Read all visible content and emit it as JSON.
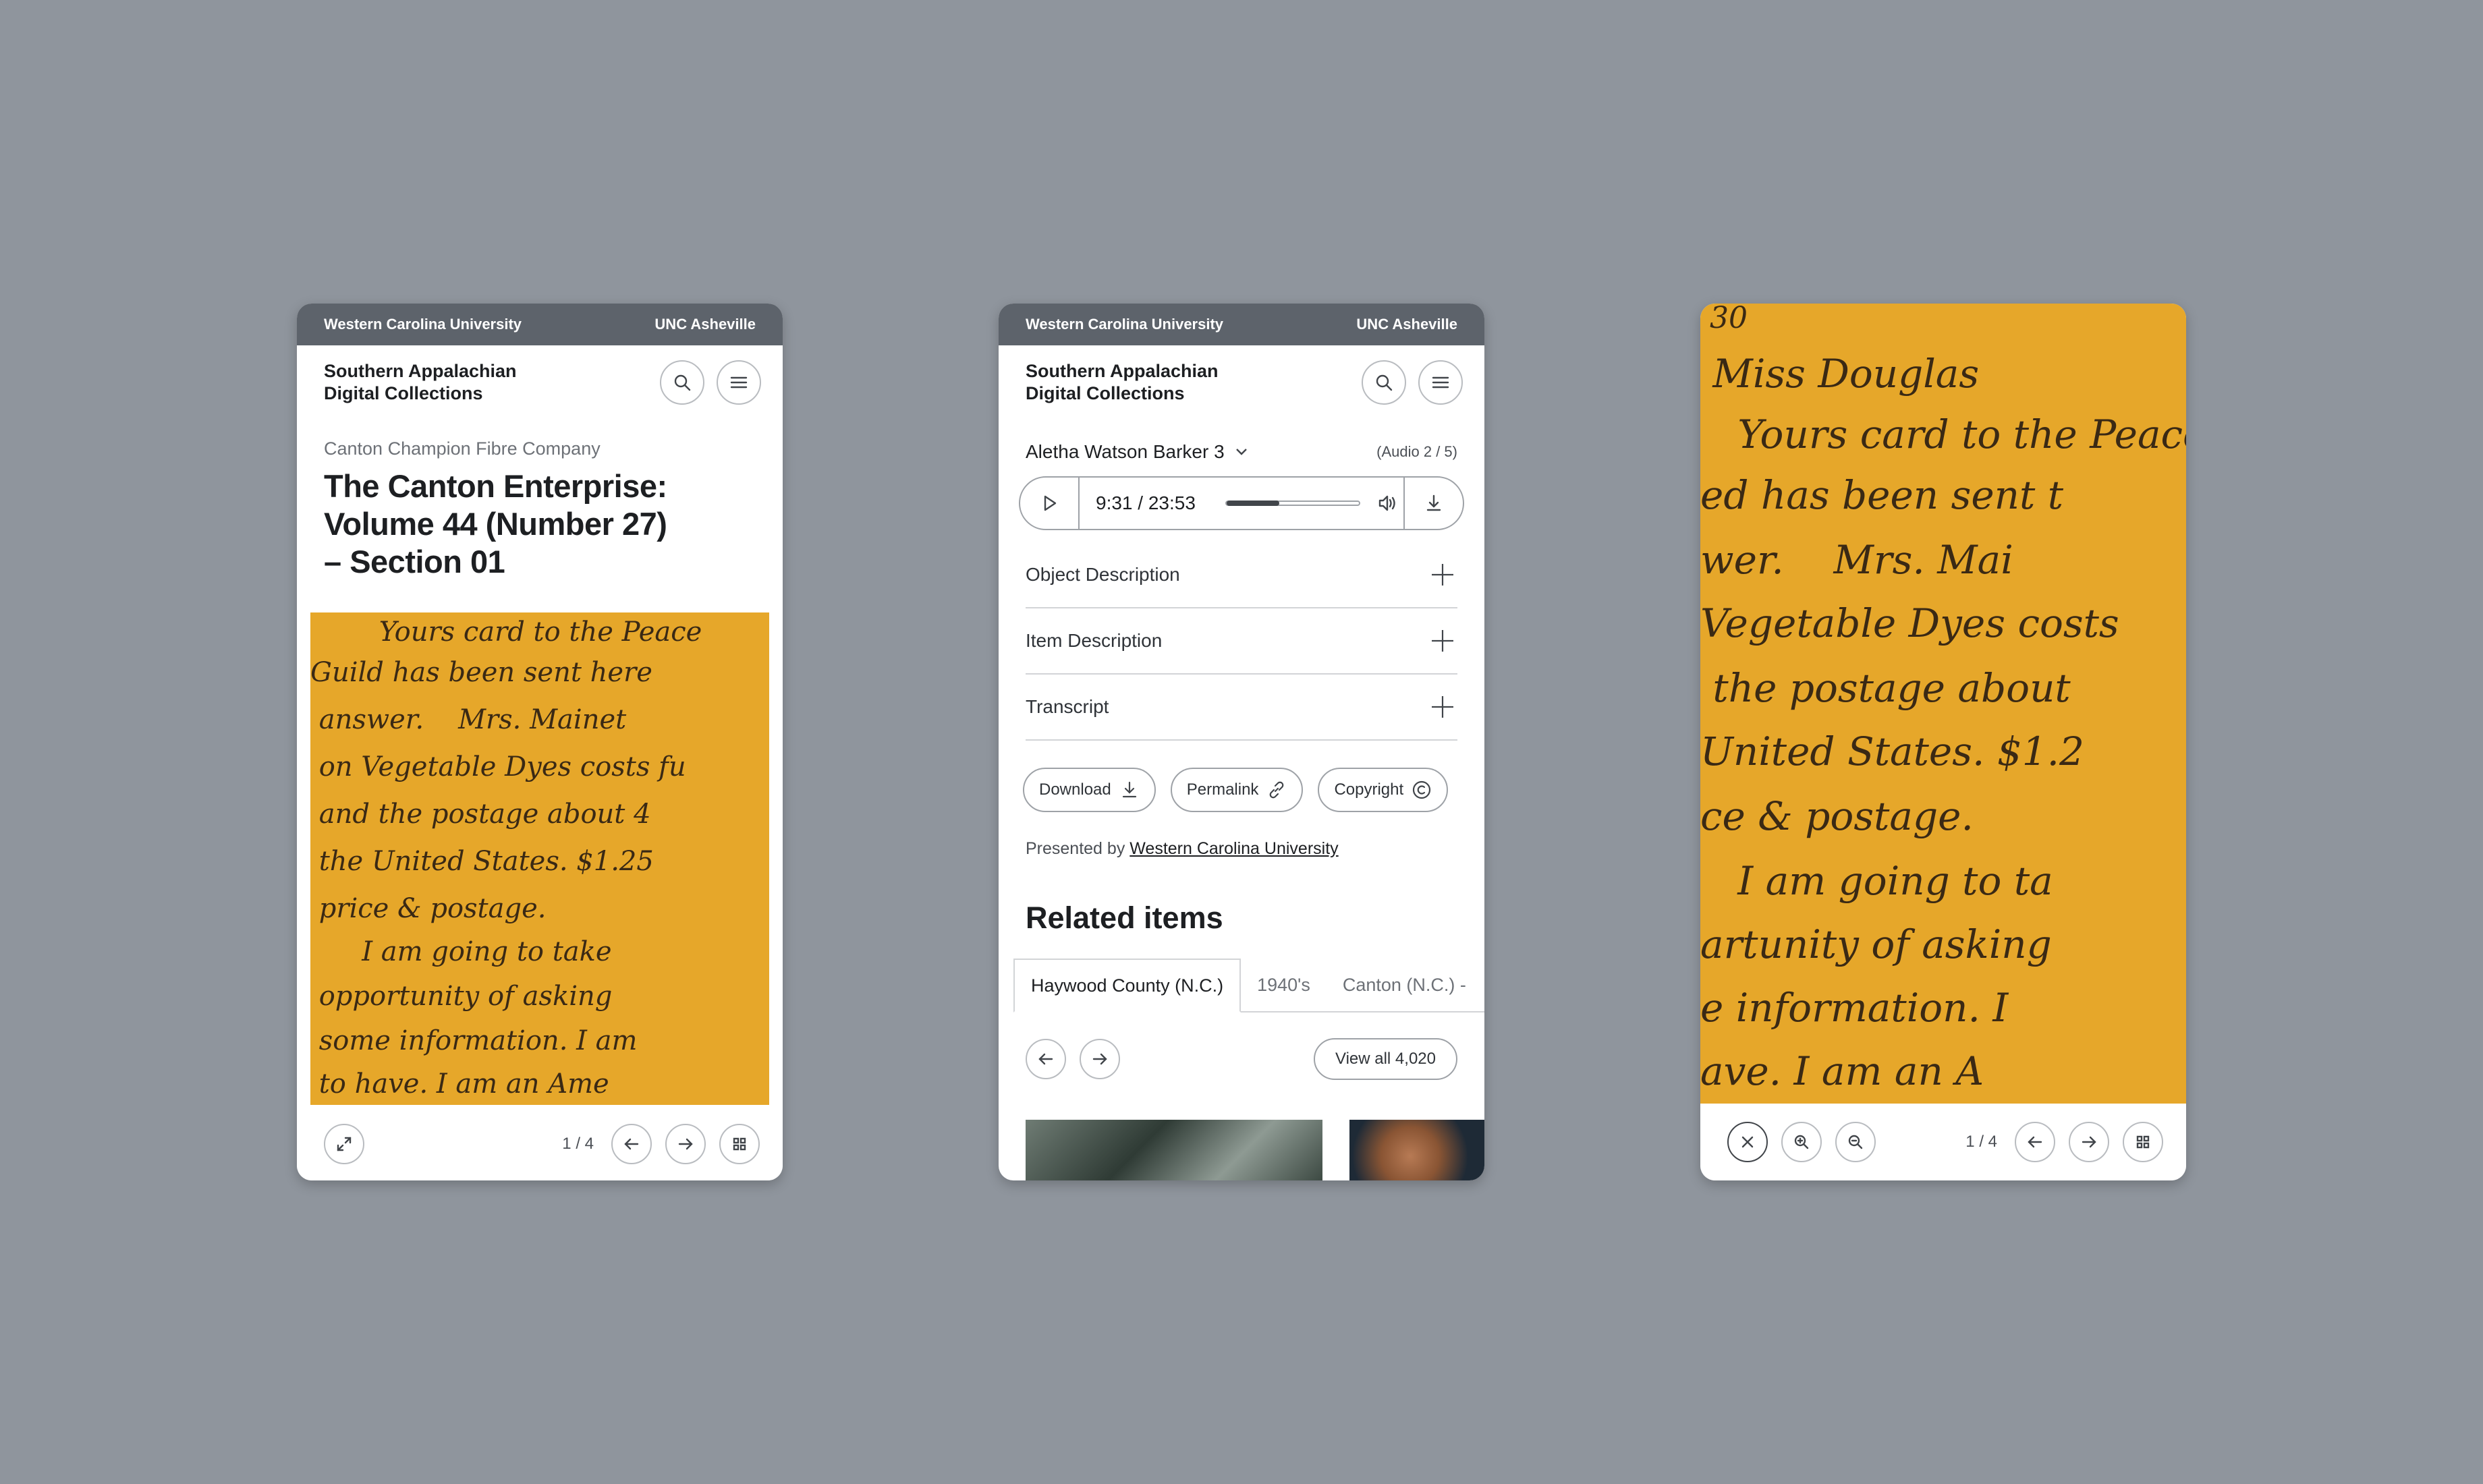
{
  "topbar": {
    "left": "Western Carolina University",
    "right": "UNC Asheville"
  },
  "site_title_line1": "Southern Appalachian",
  "site_title_line2": "Digital Collections",
  "colors": {
    "background": "#8f959d",
    "topbar": "#5d636b",
    "scan": "#e6a72a",
    "ink": "#3a2914"
  },
  "screen1": {
    "kicker": "Canton Champion Fibre Company",
    "title_line1": "The Canton Enterprise:",
    "title_line2": "Volume 44 (Number 27)",
    "title_line3": "– Section 01",
    "pager": "1 / 4"
  },
  "screen2": {
    "track": "Aletha Watson Barker 3",
    "count": "(Audio 2 / 5)",
    "time": "9:31 / 23:53",
    "progress": 0.4,
    "accordion": [
      "Object Description",
      "Item Description",
      "Transcript"
    ],
    "chips": [
      "Download",
      "Permalink",
      "Copyright"
    ],
    "presented_prefix": "Presented by",
    "presented_link": "Western Carolina University",
    "related_heading": "Related items",
    "tabs": [
      "Haywood County (N.C.)",
      "1940's",
      "Canton (N.C.) -"
    ],
    "view_all": "View all 4,020"
  },
  "screen3": {
    "pager": "1 / 4"
  },
  "icons": [
    "search-icon",
    "menu-icon",
    "expand-icon",
    "arrow-left-icon",
    "arrow-right-icon",
    "grid-icon",
    "chevron-down-icon",
    "play-icon",
    "volume-icon",
    "download-icon",
    "plus-icon",
    "link-icon",
    "copyright-icon",
    "close-icon",
    "zoom-in-icon",
    "zoom-out-icon"
  ]
}
